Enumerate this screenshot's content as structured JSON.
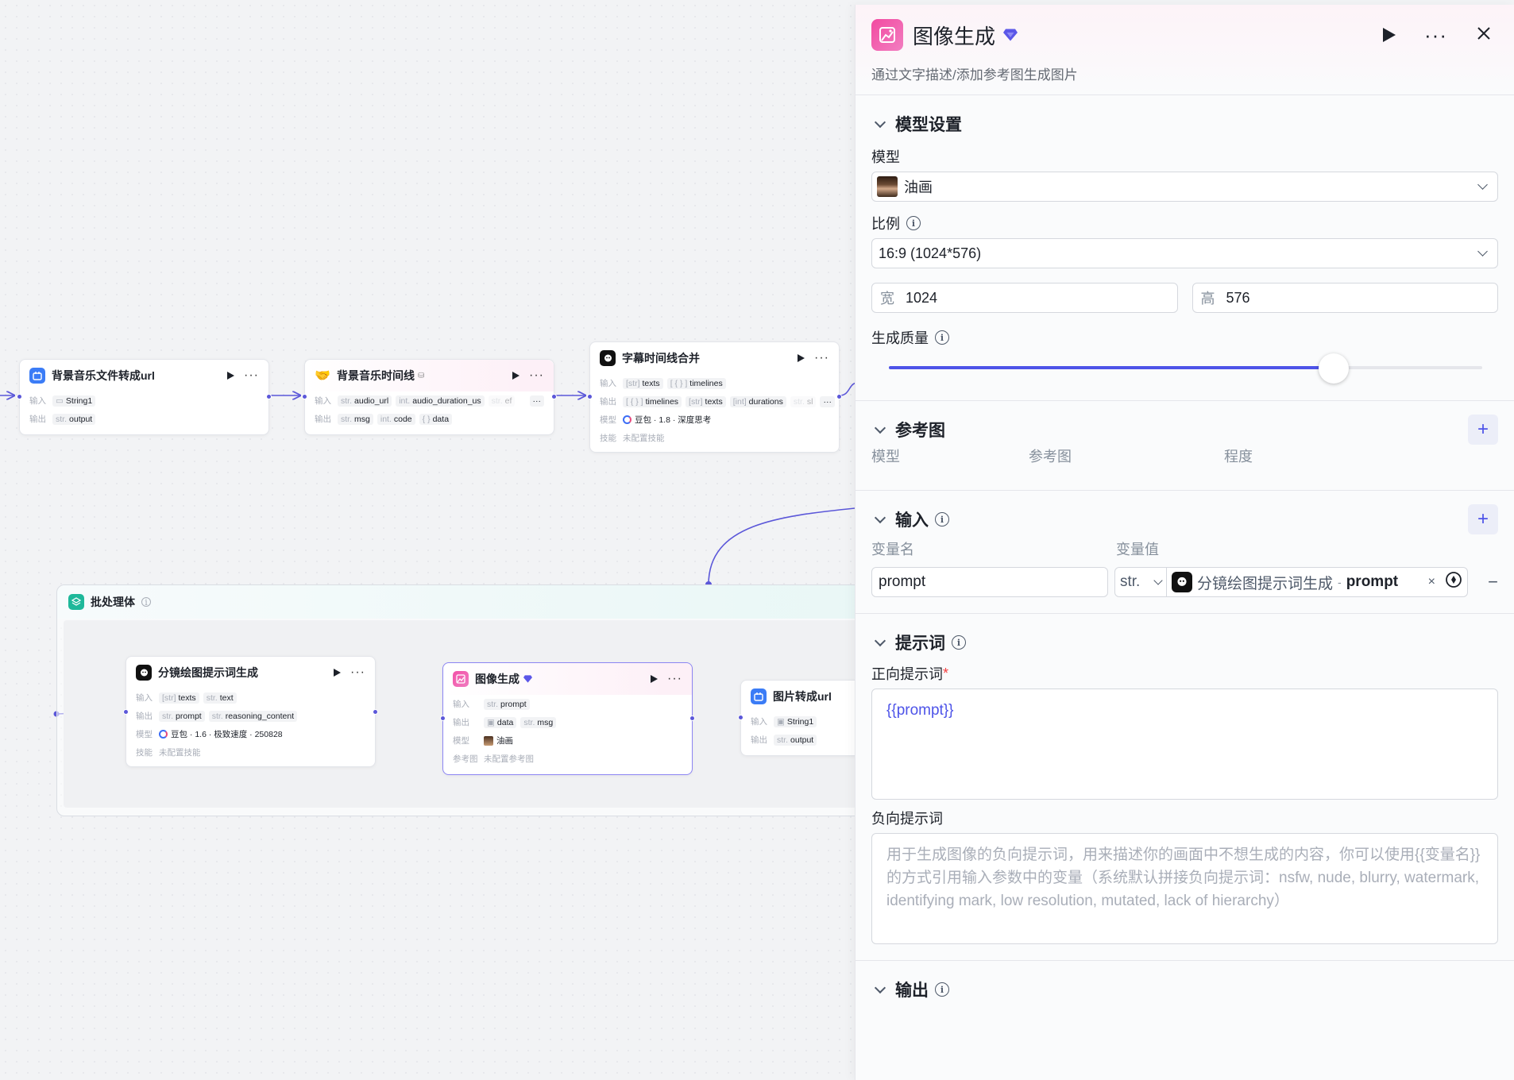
{
  "nodes": {
    "bgm_to_url": {
      "title": "背景音乐文件转成url",
      "in_key": "输入",
      "out_key": "输出",
      "in_value": "String1",
      "out_type": "str.",
      "out_value": "output"
    },
    "bgm_timeline": {
      "title": "背景音乐时间线",
      "in_key": "输入",
      "out_key": "输出",
      "in1_type": "str.",
      "in1": "audio_url",
      "in2_type": "int.",
      "in2": "audio_duration_us",
      "in3_type": "str.",
      "in3": "ef",
      "out1_type": "str.",
      "out1": "msg",
      "out2_type": "int.",
      "out2": "code",
      "out3_type": "{ }",
      "out3": "data"
    },
    "subtitle_merge": {
      "title": "字幕时间线合并",
      "in_key": "输入",
      "out_key": "输出",
      "model_key": "模型",
      "skill_key": "技能",
      "in1_type": "[str]",
      "in1": "texts",
      "in2_type": "[ { } ]",
      "in2": "timelines",
      "out1_type": "[ { } ]",
      "out1": "timelines",
      "out2_type": "[str]",
      "out2": "texts",
      "out3_type": "[int]",
      "out3": "durations",
      "out4_type": "str.",
      "out4": "sl",
      "model": "豆包 · 1.8 · 深度思考",
      "skill": "未配置技能"
    },
    "batch": {
      "title": "批处理体"
    },
    "storyboard_prompt": {
      "title": "分镜绘图提示词生成",
      "in_key": "输入",
      "out_key": "输出",
      "model_key": "模型",
      "skill_key": "技能",
      "in1_type": "[str]",
      "in1": "texts",
      "in2_type": "str.",
      "in2": "text",
      "out1_type": "str.",
      "out1": "prompt",
      "out2_type": "str.",
      "out2": "reasoning_content",
      "model": "豆包 · 1.6 · 极致速度 · 250828",
      "skill": "未配置技能"
    },
    "image_gen": {
      "title": "图像生成",
      "in_key": "输入",
      "out_key": "输出",
      "model_key": "模型",
      "ref_key": "参考图",
      "in1_type": "str.",
      "in1": "prompt",
      "out1_type": "img",
      "out1": "data",
      "out2_type": "str.",
      "out2": "msg",
      "model": "油画",
      "ref": "未配置参考图"
    },
    "img_to_url": {
      "title": "图片转成url",
      "in_key": "输入",
      "out_key": "输出",
      "in1": "String1",
      "out_type": "str.",
      "out1": "output"
    }
  },
  "panel": {
    "title": "图像生成",
    "description": "通过文字描述/添加参考图生成图片",
    "model_section": {
      "title": "模型设置",
      "model_label": "模型",
      "model_value": "油画",
      "ratio_label": "比例",
      "ratio_value": "16:9 (1024*576)",
      "width_label": "宽",
      "width_value": "1024",
      "height_label": "高",
      "height_value": "576",
      "quality_label": "生成质量",
      "quality_fraction": 0.75
    },
    "reference_section": {
      "title": "参考图",
      "columns": [
        "模型",
        "参考图",
        "程度"
      ]
    },
    "input_section": {
      "title": "输入",
      "col_name": "变量名",
      "col_value": "变量值",
      "var_name": "prompt",
      "var_type": "str.",
      "ref_node": "分镜绘图提示词生成",
      "ref_sep": "-",
      "ref_field": "prompt"
    },
    "prompt_section": {
      "title": "提示词",
      "positive_label": "正向提示词",
      "required_mark": "*",
      "positive_value": "{{prompt}}",
      "negative_label": "负向提示词",
      "negative_placeholder": "用于生成图像的负向提示词，用来描述你的画面中不想生成的内容，你可以使用{{变量名}}的方式引用输入参数中的变量（系统默认拼接负向提示词：nsfw, nude, blurry, watermark, identifying mark, low resolution, mutated, lack of hierarchy）"
    },
    "output_section": {
      "title": "输出"
    }
  },
  "colors": {
    "accent": "#4d53e8",
    "edge": "#5b57d9",
    "pink": "#f24aa0"
  }
}
